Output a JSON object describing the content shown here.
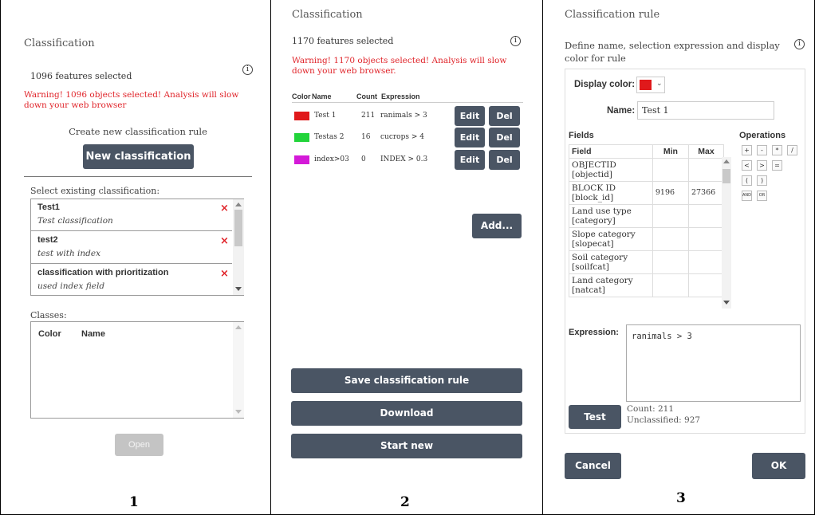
{
  "panel1": {
    "title": "Classification",
    "features_selected": "1096 features selected",
    "warning": "Warning! 1096 objects selected! Analysis will slow down your web browser",
    "create_label": "Create new classification rule",
    "new_button": "New classification",
    "select_label": "Select existing classification:",
    "classifications": [
      {
        "name": "Test1",
        "desc": "Test classification"
      },
      {
        "name": "test2",
        "desc": "test with index"
      },
      {
        "name": "classification with prioritization",
        "desc": "used index field"
      }
    ],
    "classes_label": "Classes:",
    "classes_header": {
      "color": "Color",
      "name": "Name"
    },
    "open_button": "Open",
    "figure_number": "1"
  },
  "panel2": {
    "title": "Classification",
    "features_selected": "1170 features selected",
    "warning": "Warning! 1170 objects selected! Analysis will slow down your web browser.",
    "table_header": {
      "color": "Color",
      "name": "Name",
      "count": "Count",
      "expression": "Expression"
    },
    "rules": [
      {
        "color": "#e0191b",
        "name": "Test 1",
        "count": "211",
        "expression": "ranimals > 3"
      },
      {
        "color": "#22d43a",
        "name": "Testas 2",
        "count": "16",
        "expression": "cucrops > 4"
      },
      {
        "color": "#d41ad8",
        "name": "index>03",
        "count": "0",
        "expression": "INDEX > 0.3"
      }
    ],
    "edit_label": "Edit",
    "del_label": "Del",
    "add_button": "Add...",
    "save_button": "Save classification rule",
    "download_button": "Download",
    "start_new_button": "Start new",
    "figure_number": "2"
  },
  "panel3": {
    "title": "Classification rule",
    "description": "Define name, selection expression and display color for rule",
    "display_color_label": "Display color:",
    "display_color": "#e0191b",
    "name_label": "Name:",
    "name_value": "Test 1",
    "fields_label": "Fields",
    "fields_header": {
      "field": "Field",
      "min": "Min",
      "max": "Max"
    },
    "fields": [
      {
        "field": "OBJECTID [objectid]",
        "min": "",
        "max": ""
      },
      {
        "field": "BLOCK ID [block_id]",
        "min": "9196",
        "max": "27366"
      },
      {
        "field": "Land use type [category]",
        "min": "",
        "max": ""
      },
      {
        "field": "Slope category [slopecat]",
        "min": "",
        "max": ""
      },
      {
        "field": "Soil category [soilfcat]",
        "min": "",
        "max": ""
      },
      {
        "field": "Land category [natcat]",
        "min": "",
        "max": ""
      }
    ],
    "operations_label": "Operations",
    "operations": [
      "+",
      "-",
      "*",
      "/",
      "<",
      ">",
      "=",
      "(",
      ")",
      "AND",
      "OR"
    ],
    "expression_label": "Expression:",
    "expression_value": "ranimals > 3",
    "test_button": "Test",
    "count_text": "Count: 211",
    "unclassified_text": "Unclassified: 927",
    "cancel_button": "Cancel",
    "ok_button": "OK",
    "figure_number": "3"
  },
  "colors": {
    "dark_button": "#4a5564",
    "warning": "#e0242a",
    "disabled_button": "#c4c4c4"
  }
}
